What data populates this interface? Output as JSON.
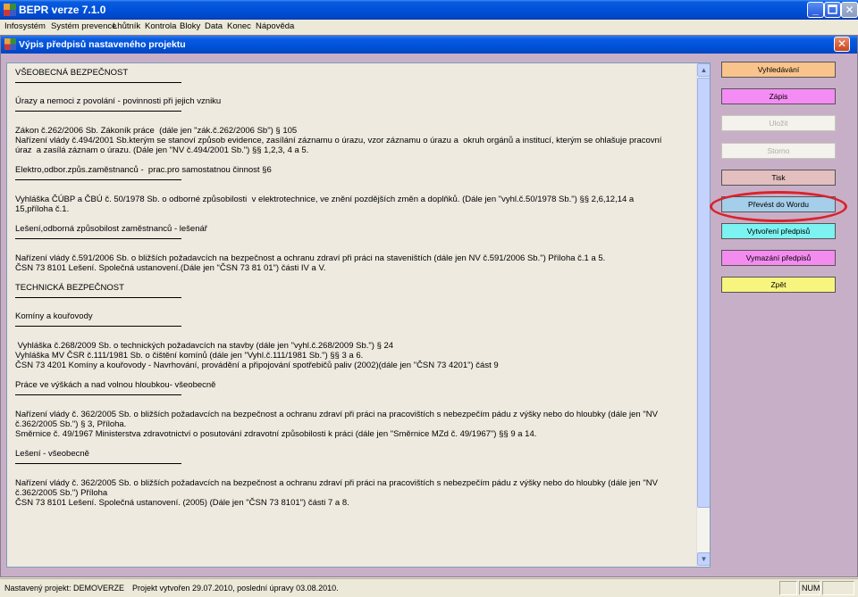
{
  "window": {
    "title": "BEPR verze 7.1.0"
  },
  "menubar": {
    "items": [
      "Infosystém",
      "Systém prevence",
      "Lhůtník",
      "Kontrola",
      "Bloky",
      "Data",
      "Konec",
      "Nápověda"
    ]
  },
  "mdi": {
    "title": "Výpis předpisů nastaveného projektu"
  },
  "content": {
    "lines": [
      {
        "type": "heading",
        "text": "VŠEOBECNÁ BEZPEČNOST"
      },
      {
        "type": "heading",
        "text": "Úrazy a nemoci z povolání - povinnosti při jejich vzniku"
      },
      {
        "type": "text",
        "text": "Zákon č.262/2006 Sb. Zákoník práce  (dále jen \"zák.č.262/2006 Sb\") § 105\nNařízení vlády č.494/2001 Sb.kterým se stanoví způsob evidence, zasílání záznamu o úrazu, vzor záznamu o úrazu a  okruh orgánů a institucí, kterým se ohlašuje pracovní\núraz  a zasílá záznam o úrazu. (Dále jen \"NV č.494/2001 Sb.\") §§ 1,2,3, 4 a 5."
      },
      {
        "type": "heading",
        "text": "Elektro,odbor.způs.zaměstnanců -  prac.pro samostatnou činnost §6"
      },
      {
        "type": "text",
        "text": "Vyhláška ČÚBP a ČBÚ č. 50/1978 Sb. o odborné způsobilosti  v elektrotechnice, ve znění pozdějších změn a doplňků. (Dále jen \"vyhl.č.50/1978 Sb.\") §§ 2,6,12,14 a\n15,příloha č.1."
      },
      {
        "type": "heading",
        "text": "Lešení,odborná způsobilost zaměstnanců - lešenář"
      },
      {
        "type": "text",
        "text": "Nařízení vlády č.591/2006 Sb. o bližších požadavcích na bezpečnost a ochranu zdraví při práci na staveništích (dále jen NV č.591/2006 Sb.\") Příloha č.1 a 5.\nČSN 73 8101 Lešení. Společná ustanovení.(Dále jen \"ČSN 73 81 01\") části IV a V."
      },
      {
        "type": "heading",
        "text": "TECHNICKÁ BEZPEČNOST"
      },
      {
        "type": "heading",
        "text": "Komíny a kouřovody"
      },
      {
        "type": "text",
        "text": " Vyhláška č.268/2009 Sb. o technických požadavcích na stavby (dále jen \"vyhl.č.268/2009 Sb.\") § 24\nVyhláška MV ČSR č.111/1981 Sb. o čištění komínů (dále jen \"Vyhl.č.111/1981 Sb.\") §§ 3 a 6.\nČSN 73 4201 Komíny a kouřovody - Navrhování, provádění a připojování spotřebičů paliv (2002)(dále jen \"ČSN 73 4201\") část 9"
      },
      {
        "type": "heading",
        "text": "Práce ve výškách a nad volnou hloubkou- všeobecně"
      },
      {
        "type": "text",
        "text": "Nařízení vlády č. 362/2005 Sb. o bližších požadavcích na bezpečnost a ochranu zdraví při práci na pracovištích s nebezpečím pádu z výšky nebo do hloubky (dále jen \"NV\nč.362/2005 Sb.\") § 3, Příloha.\nSměrnice č. 49/1967 Ministerstva zdravotnictví o posutování zdravotní způsobilosti k práci (dále jen \"Směrnice MZd č. 49/1967\") §§ 9 a 14."
      },
      {
        "type": "heading",
        "text": "Lešení - všeobecně"
      },
      {
        "type": "text",
        "text": "Nařízení vlády č. 362/2005 Sb. o bližších požadavcích na bezpečnost a ochranu zdraví při práci na pracovištích s nebezpečím pádu z výšky nebo do hloubky (dále jen \"NV\nč.362/2005 Sb.\") Příloha\nČSN 73 8101 Lešení. Společná ustanovení. (2005) (Dále jen \"ČSN 73 8101\") části 7 a 8."
      }
    ]
  },
  "buttons": {
    "search": "Vyhledávání",
    "write": "Zápis",
    "save": "Uložit",
    "cancel": "Storno",
    "print": "Tisk",
    "export_word": "Převést do Wordu",
    "create_regs": "Vytvoření předpisů",
    "delete_regs": "Vymazání předpisů",
    "back": "Zpět"
  },
  "colors": {
    "search": "#F9C48C",
    "write": "#F58CF5",
    "print": "#E3BFBF",
    "export_word": "#A4CEEA",
    "create_regs": "#7CF3F0",
    "delete_regs": "#F48CF0",
    "back": "#F8F57E",
    "highlight": "#D8232A"
  },
  "statusbar": {
    "project": "Nastavený projekt: DEMOVERZE",
    "info": "Projekt vytvořen 29.07.2010, poslední úpravy 03.08.2010.",
    "num": "NUM"
  }
}
